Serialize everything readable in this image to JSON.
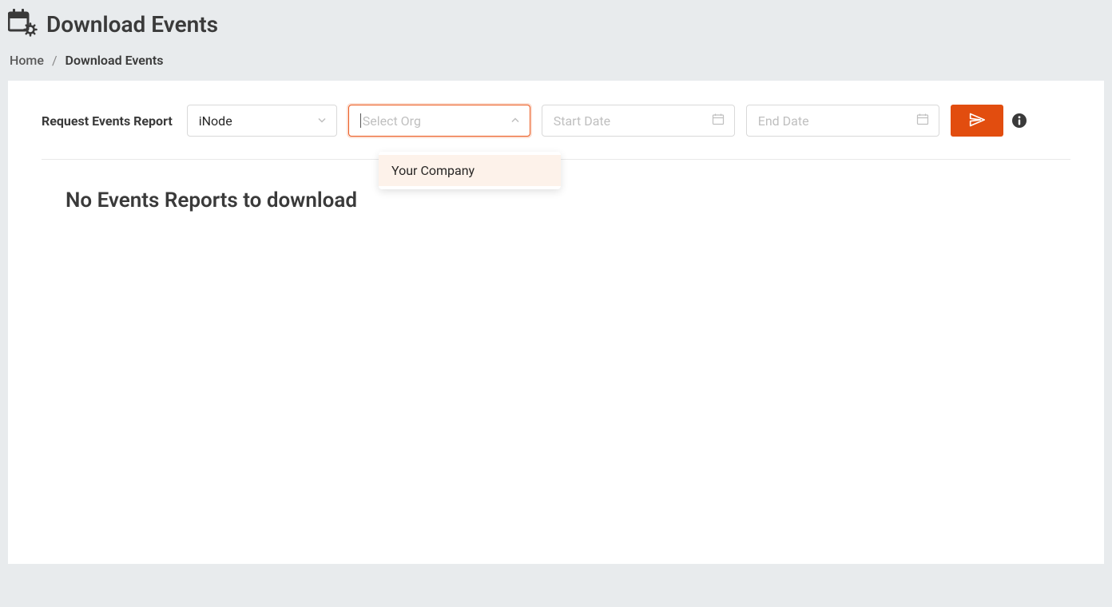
{
  "header": {
    "title": "Download Events"
  },
  "breadcrumb": {
    "home": "Home",
    "current": "Download Events",
    "separator": "/"
  },
  "filters": {
    "label": "Request Events Report",
    "inode": {
      "value": "iNode"
    },
    "org": {
      "placeholder": "Select Org",
      "options": [
        "Your Company"
      ]
    },
    "start_date": {
      "placeholder": "Start Date"
    },
    "end_date": {
      "placeholder": "End Date"
    }
  },
  "dropdown": {
    "item0": "Your Company"
  },
  "empty": {
    "message": "No Events Reports to download"
  }
}
